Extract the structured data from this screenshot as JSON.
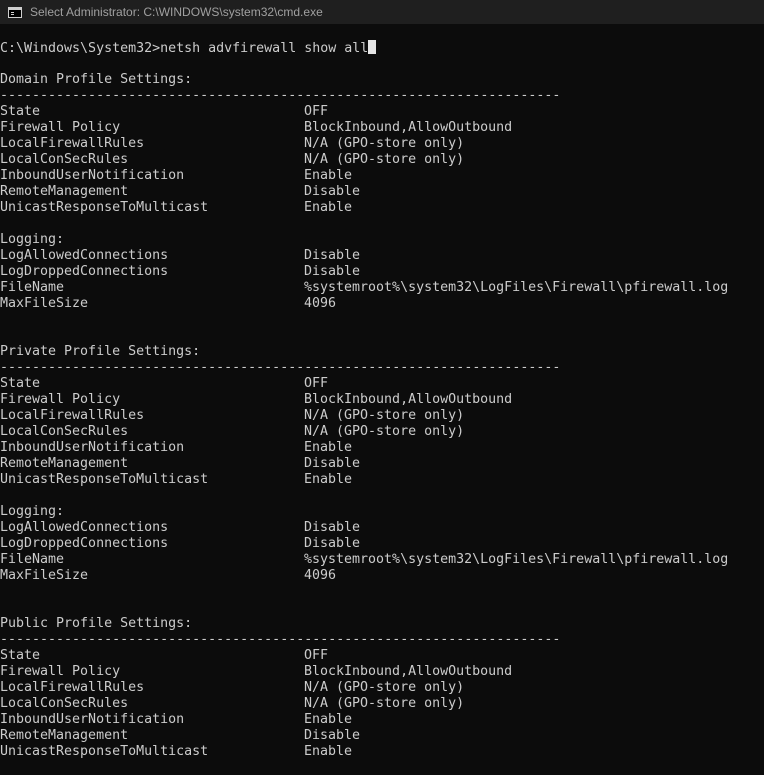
{
  "window": {
    "title": "Select Administrator: C:\\WINDOWS\\system32\\cmd.exe",
    "icon": "console-icon"
  },
  "console": {
    "prompt": "C:\\Windows\\System32>",
    "command": "netsh advfirewall show all",
    "separator": "----------------------------------------------------------------------",
    "profiles": [
      {
        "header": "Domain Profile Settings:",
        "settings": [
          {
            "key": "State",
            "value": "OFF"
          },
          {
            "key": "Firewall Policy",
            "value": "BlockInbound,AllowOutbound"
          },
          {
            "key": "LocalFirewallRules",
            "value": "N/A (GPO-store only)"
          },
          {
            "key": "LocalConSecRules",
            "value": "N/A (GPO-store only)"
          },
          {
            "key": "InboundUserNotification",
            "value": "Enable"
          },
          {
            "key": "RemoteManagement",
            "value": "Disable"
          },
          {
            "key": "UnicastResponseToMulticast",
            "value": "Enable"
          }
        ],
        "logging_header": "Logging:",
        "logging": [
          {
            "key": "LogAllowedConnections",
            "value": "Disable"
          },
          {
            "key": "LogDroppedConnections",
            "value": "Disable"
          },
          {
            "key": "FileName",
            "value": "%systemroot%\\system32\\LogFiles\\Firewall\\pfirewall.log"
          },
          {
            "key": "MaxFileSize",
            "value": "4096"
          }
        ]
      },
      {
        "header": "Private Profile Settings:",
        "settings": [
          {
            "key": "State",
            "value": "OFF"
          },
          {
            "key": "Firewall Policy",
            "value": "BlockInbound,AllowOutbound"
          },
          {
            "key": "LocalFirewallRules",
            "value": "N/A (GPO-store only)"
          },
          {
            "key": "LocalConSecRules",
            "value": "N/A (GPO-store only)"
          },
          {
            "key": "InboundUserNotification",
            "value": "Enable"
          },
          {
            "key": "RemoteManagement",
            "value": "Disable"
          },
          {
            "key": "UnicastResponseToMulticast",
            "value": "Enable"
          }
        ],
        "logging_header": "Logging:",
        "logging": [
          {
            "key": "LogAllowedConnections",
            "value": "Disable"
          },
          {
            "key": "LogDroppedConnections",
            "value": "Disable"
          },
          {
            "key": "FileName",
            "value": "%systemroot%\\system32\\LogFiles\\Firewall\\pfirewall.log"
          },
          {
            "key": "MaxFileSize",
            "value": "4096"
          }
        ]
      },
      {
        "header": "Public Profile Settings:",
        "settings": [
          {
            "key": "State",
            "value": "OFF"
          },
          {
            "key": "Firewall Policy",
            "value": "BlockInbound,AllowOutbound"
          },
          {
            "key": "LocalFirewallRules",
            "value": "N/A (GPO-store only)"
          },
          {
            "key": "LocalConSecRules",
            "value": "N/A (GPO-store only)"
          },
          {
            "key": "InboundUserNotification",
            "value": "Enable"
          },
          {
            "key": "RemoteManagement",
            "value": "Disable"
          },
          {
            "key": "UnicastResponseToMulticast",
            "value": "Enable"
          }
        ]
      }
    ]
  },
  "colors": {
    "background": "#0c0c0c",
    "titlebar": "#1f1f1f",
    "text": "#cccccc"
  }
}
